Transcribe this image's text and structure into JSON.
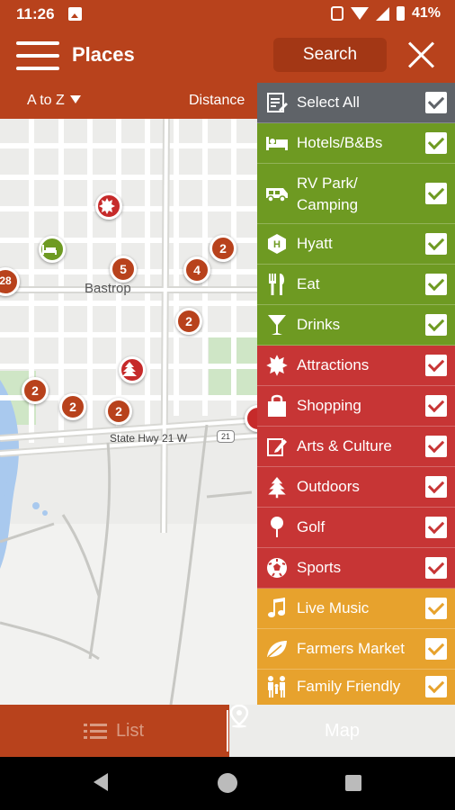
{
  "status_bar": {
    "time": "11:26",
    "battery": "41%"
  },
  "app_bar": {
    "title": "Places",
    "search_label": "Search"
  },
  "sort_bar": {
    "az_label": "A to Z",
    "distance_label": "Distance"
  },
  "map": {
    "town_label": "Bastrop",
    "road_label": "State Hwy 21 W",
    "shield_label": "21",
    "pins": [
      {
        "label": "28"
      },
      {
        "label": "2"
      },
      {
        "label": "5"
      },
      {
        "label": "4"
      },
      {
        "label": "2"
      },
      {
        "label": "2"
      },
      {
        "label": "2"
      },
      {
        "label": "2"
      }
    ]
  },
  "filters": [
    {
      "label": "Select All",
      "icon": "edit-list-icon",
      "checked": true,
      "color": "#5f6368"
    },
    {
      "label": "Hotels/B&Bs",
      "icon": "bed-icon",
      "checked": true,
      "color": "#6e9a22"
    },
    {
      "label": "RV Park/ Camping",
      "icon": "rv-icon",
      "checked": true,
      "color": "#6e9a22"
    },
    {
      "label": "Hyatt",
      "icon": "hexagon-icon",
      "checked": true,
      "color": "#6e9a22"
    },
    {
      "label": "Eat",
      "icon": "utensils-icon",
      "checked": true,
      "color": "#6e9a22"
    },
    {
      "label": "Drinks",
      "icon": "cocktail-icon",
      "checked": true,
      "color": "#6e9a22"
    },
    {
      "label": "Attractions",
      "icon": "starburst-icon",
      "checked": true,
      "color": "#c73535"
    },
    {
      "label": "Shopping",
      "icon": "shopping-bag-icon",
      "checked": true,
      "color": "#c73535"
    },
    {
      "label": "Arts & Culture",
      "icon": "pencil-icon",
      "checked": true,
      "color": "#c73535"
    },
    {
      "label": "Outdoors",
      "icon": "tree-icon",
      "checked": true,
      "color": "#c73535"
    },
    {
      "label": "Golf",
      "icon": "golf-icon",
      "checked": true,
      "color": "#c73535"
    },
    {
      "label": "Sports",
      "icon": "soccer-ball-icon",
      "checked": true,
      "color": "#c73535"
    },
    {
      "label": "Live Music",
      "icon": "music-note-icon",
      "checked": true,
      "color": "#e7a22d"
    },
    {
      "label": "Farmers Market",
      "icon": "leaf-icon",
      "checked": true,
      "color": "#e7a22d"
    },
    {
      "label": "Family Friendly",
      "icon": "family-icon",
      "checked": true,
      "color": "#e7a22d"
    }
  ],
  "bottom_tabs": {
    "list_label": "List",
    "map_label": "Map"
  },
  "colors": {
    "brand": "#b8421c",
    "green": "#6e9a22",
    "red": "#c73535",
    "amber": "#e7a22d",
    "gray": "#5f6368"
  }
}
